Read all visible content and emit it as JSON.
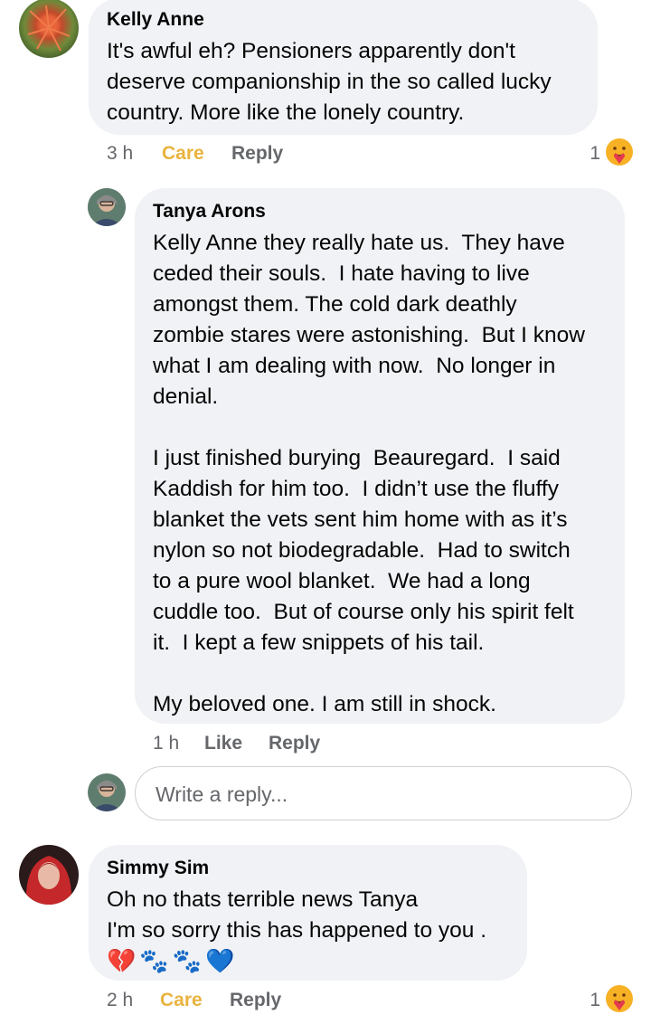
{
  "comments": [
    {
      "author": "Kelly Anne",
      "text": "It's awful eh? Pensioners apparently don't\ndeserve companionship in the so called lucky\ncountry. More like the lonely country.",
      "time": "3 h",
      "reaction_label": "Care",
      "reply_label": "Reply",
      "reaction_count": "1"
    },
    {
      "author": "Tanya Arons",
      "text": "Kelly Anne they really hate us.  They have\nceded their souls.  I hate having to live\namongst them. The cold dark deathly\nzombie stares were astonishing.  But I know\nwhat I am dealing with now.  No longer in\ndenial.\n\nI just finished burying  Beauregard.  I said\nKaddish for him too.  I didn’t use the fluffy\nblanket the vets sent him home with as it’s\nnylon so not biodegradable.  Had to switch\nto a pure wool blanket.  We had a long\ncuddle too.  But of course only his spirit felt\nit.  I kept a few snippets of his tail.\n\nMy beloved one. I am still in shock.",
      "time": "1 h",
      "like_label": "Like",
      "reply_label": "Reply"
    },
    {
      "author": "Simmy Sim",
      "text": "Oh no thats terrible news Tanya\nI'm so sorry this has happened to you .",
      "emojis": "💔🐾🐾💙",
      "time": "2 h",
      "reaction_label": "Care",
      "reply_label": "Reply",
      "reaction_count": "1"
    }
  ],
  "reply_input": {
    "placeholder": "Write a reply..."
  },
  "colors": {
    "bubble": "#f0f2f5",
    "meta_text": "#65676b",
    "care": "#e9b33e"
  }
}
